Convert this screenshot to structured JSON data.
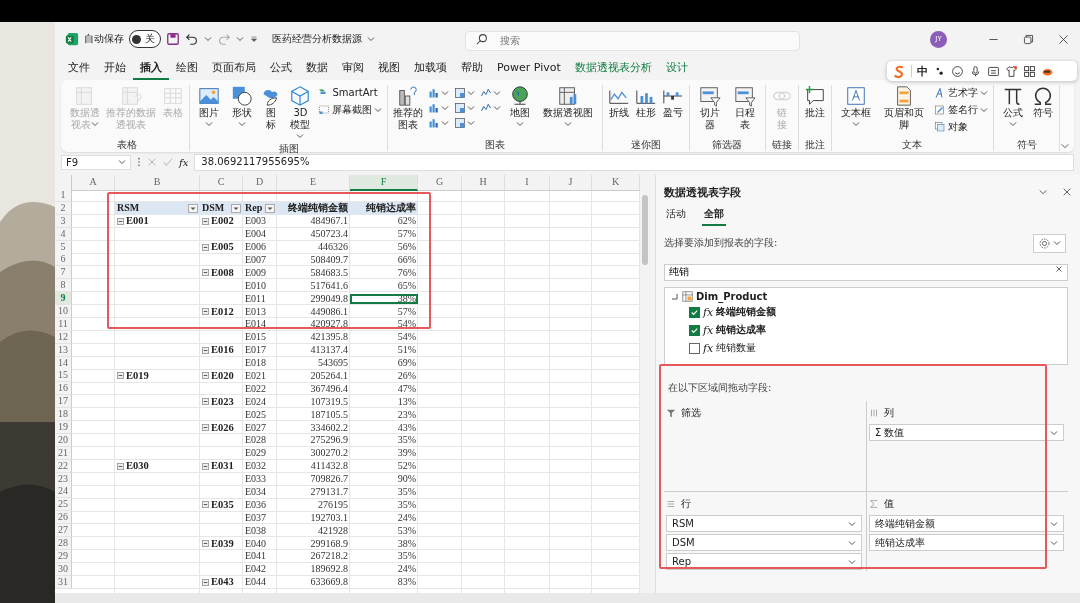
{
  "window": {
    "title": "医药经营分析数据源",
    "autosave_label": "自动保存",
    "autosave": {
      "on": false,
      "label": "关"
    },
    "search": {
      "placeholder": "搜索"
    },
    "avatar": "JY"
  },
  "menu_tabs": [
    {
      "label": "文件",
      "selected": false,
      "kind": "normal"
    },
    {
      "label": "开始",
      "selected": false,
      "kind": "normal"
    },
    {
      "label": "插入",
      "selected": true,
      "kind": "normal"
    },
    {
      "label": "绘图",
      "selected": false,
      "kind": "normal"
    },
    {
      "label": "页面布局",
      "selected": false,
      "kind": "normal"
    },
    {
      "label": "公式",
      "selected": false,
      "kind": "normal"
    },
    {
      "label": "数据",
      "selected": false,
      "kind": "normal"
    },
    {
      "label": "审阅",
      "selected": false,
      "kind": "normal"
    },
    {
      "label": "视图",
      "selected": false,
      "kind": "normal"
    },
    {
      "label": "加载项",
      "selected": false,
      "kind": "normal"
    },
    {
      "label": "帮助",
      "selected": false,
      "kind": "normal"
    },
    {
      "label": "Power Pivot",
      "selected": false,
      "kind": "normal"
    },
    {
      "label": "数据透视表分析",
      "selected": false,
      "kind": "context"
    },
    {
      "label": "设计",
      "selected": false,
      "kind": "context"
    }
  ],
  "ime_toolbar": {
    "mode": "中"
  },
  "ribbon": {
    "groups": [
      {
        "label": "表格",
        "items": [
          {
            "kind": "large",
            "label": "数据透视表",
            "caret": true,
            "disabled": true
          },
          {
            "kind": "large",
            "label": "推荐的数据透视表",
            "caret": false,
            "disabled": true
          },
          {
            "kind": "large",
            "label": "表格",
            "caret": false,
            "disabled": true
          }
        ]
      },
      {
        "label": "插图",
        "items": [
          {
            "kind": "large",
            "label": "图片",
            "caret": true,
            "disabled": false
          },
          {
            "kind": "large",
            "label": "形状",
            "caret": true,
            "disabled": false
          },
          {
            "kind": "large",
            "label": "图标",
            "caret": false,
            "disabled": false
          },
          {
            "kind": "large",
            "label": "3D 模型",
            "caret": true,
            "disabled": false
          },
          {
            "kind": "small",
            "label": "SmartArt",
            "caret": false,
            "disabled": false
          },
          {
            "kind": "small",
            "label": "屏幕截图",
            "caret": true,
            "disabled": false
          }
        ]
      },
      {
        "label": "图表",
        "items": [
          {
            "kind": "large",
            "label": "推荐的图表",
            "caret": false,
            "disabled": false
          },
          {
            "kind": "gallery"
          },
          {
            "kind": "large",
            "label": "地图",
            "caret": true,
            "disabled": false
          },
          {
            "kind": "large",
            "label": "数据透视图",
            "caret": true,
            "disabled": false
          }
        ]
      },
      {
        "label": "迷你图",
        "items": [
          {
            "kind": "large",
            "label": "折线",
            "caret": false,
            "disabled": false
          },
          {
            "kind": "large",
            "label": "柱形",
            "caret": false,
            "disabled": false
          },
          {
            "kind": "large",
            "label": "盈亏",
            "caret": false,
            "disabled": false
          }
        ]
      },
      {
        "label": "筛选器",
        "items": [
          {
            "kind": "large",
            "label": "切片器",
            "caret": false,
            "disabled": false
          },
          {
            "kind": "large",
            "label": "日程表",
            "caret": false,
            "disabled": false
          }
        ]
      },
      {
        "label": "链接",
        "items": [
          {
            "kind": "large",
            "label": "链接",
            "caret": false,
            "disabled": true
          }
        ]
      },
      {
        "label": "批注",
        "items": [
          {
            "kind": "large",
            "label": "批注",
            "caret": false,
            "disabled": false
          }
        ]
      },
      {
        "label": "文本",
        "items": [
          {
            "kind": "large",
            "label": "文本框",
            "caret": true,
            "disabled": false
          },
          {
            "kind": "large",
            "label": "页眉和页脚",
            "caret": false,
            "disabled": false
          },
          {
            "kind": "small",
            "label": "艺术字",
            "caret": true,
            "disabled": false
          },
          {
            "kind": "small",
            "label": "签名行",
            "caret": true,
            "disabled": false
          },
          {
            "kind": "small",
            "label": "对象",
            "caret": false,
            "disabled": false
          }
        ]
      },
      {
        "label": "符号",
        "items": [
          {
            "kind": "large",
            "label": "公式",
            "caret": true,
            "disabled": false
          },
          {
            "kind": "large",
            "label": "符号",
            "caret": false,
            "disabled": false
          }
        ]
      }
    ]
  },
  "formula_bar": {
    "cell": "F9",
    "fx": "fx",
    "value": "38.0692117955695%"
  },
  "sheet": {
    "columns": [
      {
        "label": "A",
        "selected": false
      },
      {
        "label": "B",
        "selected": false
      },
      {
        "label": "C",
        "selected": false
      },
      {
        "label": "D",
        "selected": false
      },
      {
        "label": "E",
        "selected": false
      },
      {
        "label": "F",
        "selected": true
      },
      {
        "label": "G",
        "selected": false
      },
      {
        "label": "H",
        "selected": false
      },
      {
        "label": "I",
        "selected": false
      },
      {
        "label": "J",
        "selected": false
      },
      {
        "label": "K",
        "selected": false
      }
    ],
    "rows": [
      {
        "number": "1",
        "kind": "blank",
        "selected": false
      },
      {
        "number": "2",
        "kind": "header",
        "selected": false,
        "cells": [
          {
            "text": "RSM",
            "filter": true
          },
          {
            "text": "DSM",
            "filter": true
          },
          {
            "text": "Rep",
            "filter": true
          },
          {
            "text": "终端纯销金额",
            "filter": false
          },
          {
            "text": "纯销达成率",
            "filter": false
          }
        ]
      },
      {
        "number": "3",
        "kind": "data",
        "selected": false,
        "rsm": "E001",
        "dsm": "E002",
        "rep": "E003",
        "amount": "484967.1",
        "rate": "62%"
      },
      {
        "number": "4",
        "kind": "data",
        "selected": false,
        "rep": "E004",
        "amount": "450723.4",
        "rate": "57%"
      },
      {
        "number": "5",
        "kind": "data",
        "selected": false,
        "dsm": "E005",
        "rep": "E006",
        "amount": "446326",
        "rate": "56%"
      },
      {
        "number": "6",
        "kind": "data",
        "selected": false,
        "rep": "E007",
        "amount": "508409.7",
        "rate": "66%"
      },
      {
        "number": "7",
        "kind": "data",
        "selected": false,
        "dsm": "E008",
        "rep": "E009",
        "amount": "584683.5",
        "rate": "76%"
      },
      {
        "number": "8",
        "kind": "data",
        "selected": false,
        "rep": "E010",
        "amount": "517641.6",
        "rate": "65%"
      },
      {
        "number": "9",
        "kind": "data",
        "selected": true,
        "rep": "E011",
        "amount": "299049.8",
        "rate": "38%"
      },
      {
        "number": "10",
        "kind": "data",
        "selected": false,
        "dsm": "E012",
        "rep": "E013",
        "amount": "449086.1",
        "rate": "57%"
      },
      {
        "number": "11",
        "kind": "data",
        "selected": false,
        "rep": "E014",
        "amount": "420927.8",
        "rate": "54%"
      },
      {
        "number": "12",
        "kind": "data",
        "selected": false,
        "rep": "E015",
        "amount": "421395.8",
        "rate": "54%"
      },
      {
        "number": "13",
        "kind": "data",
        "selected": false,
        "dsm": "E016",
        "rep": "E017",
        "amount": "413137.4",
        "rate": "51%"
      },
      {
        "number": "14",
        "kind": "data",
        "selected": false,
        "rep": "E018",
        "amount": "543695",
        "rate": "69%"
      },
      {
        "number": "15",
        "kind": "data",
        "selected": false,
        "rsm": "E019",
        "dsm": "E020",
        "rep": "E021",
        "amount": "205264.1",
        "rate": "26%"
      },
      {
        "number": "16",
        "kind": "data",
        "selected": false,
        "rep": "E022",
        "amount": "367496.4",
        "rate": "47%"
      },
      {
        "number": "17",
        "kind": "data",
        "selected": false,
        "dsm": "E023",
        "rep": "E024",
        "amount": "107319.5",
        "rate": "13%"
      },
      {
        "number": "18",
        "kind": "data",
        "selected": false,
        "rep": "E025",
        "amount": "187105.5",
        "rate": "23%"
      },
      {
        "number": "19",
        "kind": "data",
        "selected": false,
        "dsm": "E026",
        "rep": "E027",
        "amount": "334602.2",
        "rate": "43%"
      },
      {
        "number": "20",
        "kind": "data",
        "selected": false,
        "rep": "E028",
        "amount": "275296.9",
        "rate": "35%"
      },
      {
        "number": "21",
        "kind": "data",
        "selected": false,
        "rep": "E029",
        "amount": "300270.2",
        "rate": "39%"
      },
      {
        "number": "22",
        "kind": "data",
        "selected": false,
        "rsm": "E030",
        "dsm": "E031",
        "rep": "E032",
        "amount": "411432.8",
        "rate": "52%"
      },
      {
        "number": "23",
        "kind": "data",
        "selected": false,
        "rep": "E033",
        "amount": "709826.7",
        "rate": "90%"
      },
      {
        "number": "24",
        "kind": "data",
        "selected": false,
        "rep": "E034",
        "amount": "279131.7",
        "rate": "35%"
      },
      {
        "number": "25",
        "kind": "data",
        "selected": false,
        "dsm": "E035",
        "rep": "E036",
        "amount": "276195",
        "rate": "35%"
      },
      {
        "number": "26",
        "kind": "data",
        "selected": false,
        "rep": "E037",
        "amount": "192703.1",
        "rate": "24%"
      },
      {
        "number": "27",
        "kind": "data",
        "selected": false,
        "rep": "E038",
        "amount": "421928",
        "rate": "53%"
      },
      {
        "number": "28",
        "kind": "data",
        "selected": false,
        "dsm": "E039",
        "rep": "E040",
        "amount": "299168.9",
        "rate": "38%"
      },
      {
        "number": "29",
        "kind": "data",
        "selected": false,
        "rep": "E041",
        "amount": "267218.2",
        "rate": "35%"
      },
      {
        "number": "30",
        "kind": "data",
        "selected": false,
        "rep": "E042",
        "amount": "189692.8",
        "rate": "24%"
      },
      {
        "number": "31",
        "kind": "data",
        "selected": false,
        "dsm": "E043",
        "rep": "E044",
        "amount": "633669.8",
        "rate": "83%"
      }
    ]
  },
  "pivot_pane": {
    "title": "数据透视表字段",
    "tabs": [
      {
        "label": "活动",
        "selected": false
      },
      {
        "label": "全部",
        "selected": true
      }
    ],
    "prompt": "选择要添加到报表的字段:",
    "search": {
      "value": "纯销"
    },
    "table": {
      "name": "Dim_Product",
      "expanded": true,
      "children": [
        {
          "prefix": "fx",
          "label": "终端纯销金额",
          "checked": true
        },
        {
          "prefix": "fx",
          "label": "纯销达成率",
          "checked": true
        },
        {
          "prefix": "fx",
          "label": "纯销数量",
          "checked": false
        }
      ]
    },
    "areas_prompt": "在以下区域间拖动字段:",
    "areas": [
      {
        "kind": "filter",
        "title": "筛选"
      },
      {
        "kind": "columns",
        "title": "列",
        "fields": [
          "Σ 数值"
        ]
      },
      {
        "kind": "rows",
        "title": "行",
        "fields": [
          "RSM",
          "DSM",
          "Rep"
        ]
      },
      {
        "kind": "values",
        "title": "值",
        "fields": [
          "终端纯销金额",
          "纯销达成率"
        ]
      }
    ]
  }
}
